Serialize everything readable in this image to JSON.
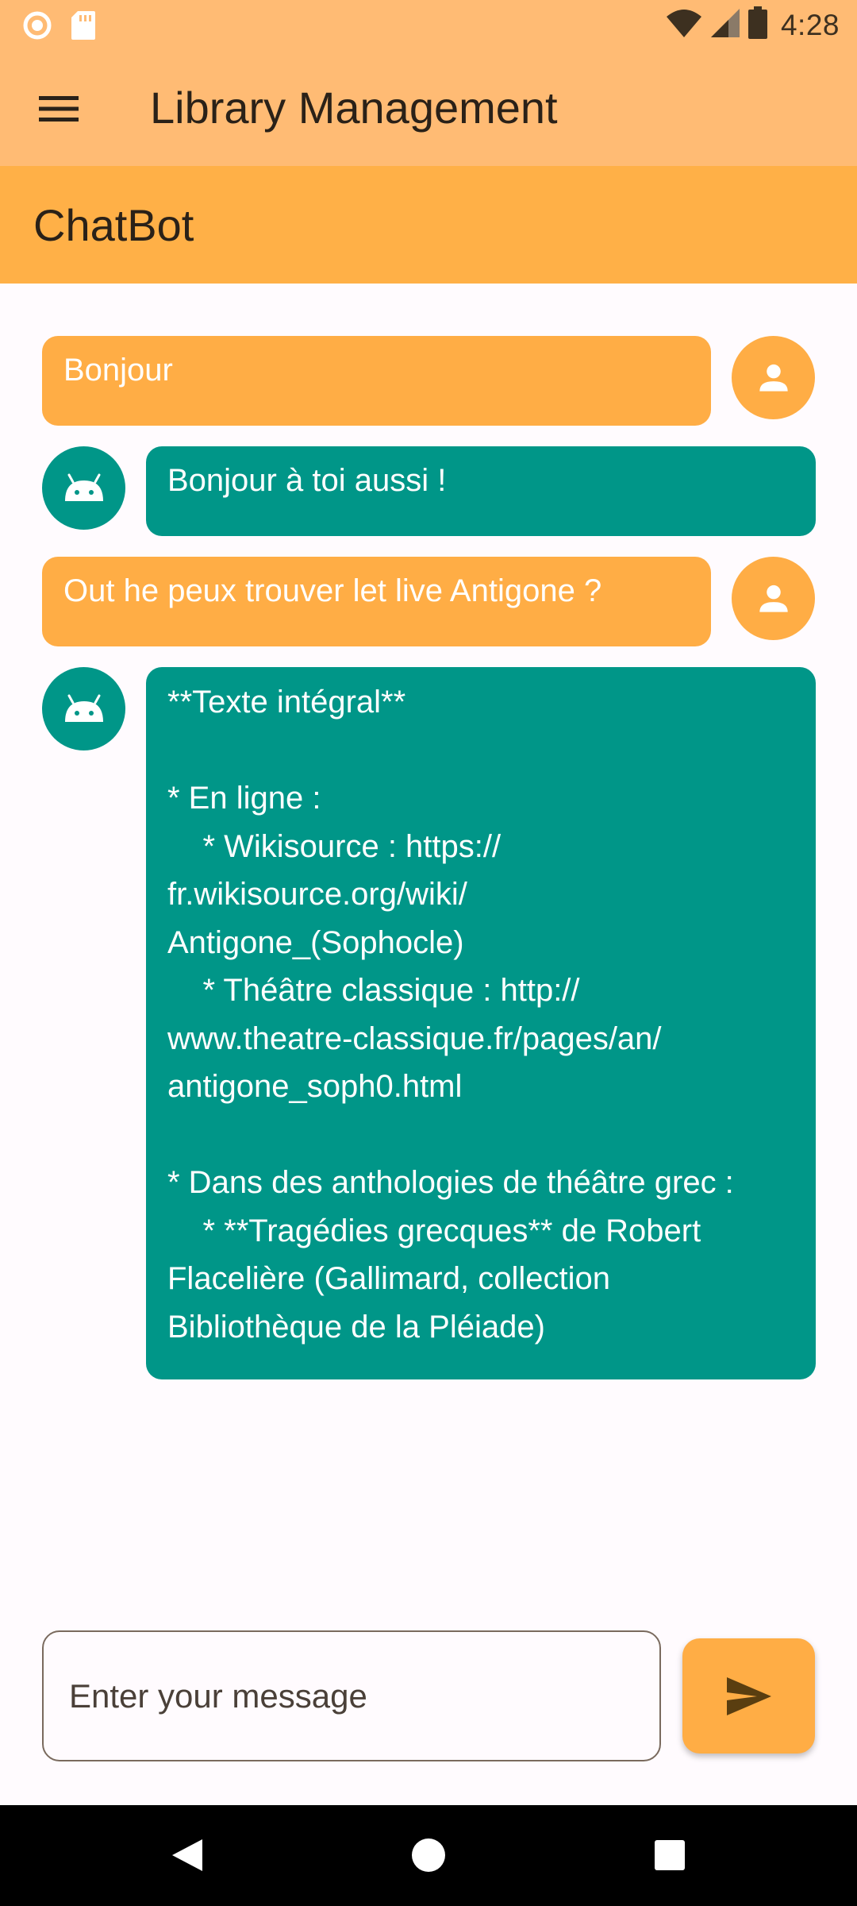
{
  "status_bar": {
    "time": "4:28",
    "icons": [
      "radio-icon",
      "sd-card-icon",
      "wifi-icon",
      "signal-icon",
      "battery-icon"
    ]
  },
  "app_bar": {
    "title": "Library Management",
    "menu_icon": "hamburger-menu-icon"
  },
  "sub_header": {
    "title": "ChatBot"
  },
  "messages": [
    {
      "sender": "user",
      "text": "Bonjour"
    },
    {
      "sender": "bot",
      "text": "Bonjour à toi aussi !"
    },
    {
      "sender": "user",
      "text": "Out he peux trouver let live Antigone ?"
    },
    {
      "sender": "bot",
      "text": "**Texte intégral**\n\n* En ligne :\n    * Wikisource : https://\nfr.wikisource.org/wiki/\nAntigone_(Sophocle)\n    * Théâtre classique : http://\nwww.theatre-classique.fr/pages/an/\nantigone_soph0.html\n\n* Dans des anthologies de théâtre grec :\n    * **Tragédies grecques** de Robert\nFlacelière (Gallimard, collection\nBibliothèque de la Pléiade)"
    }
  ],
  "input": {
    "placeholder": "Enter your message",
    "value": ""
  },
  "send_button": {
    "icon": "send-icon"
  },
  "nav_bar": {
    "icons": [
      "back-icon",
      "home-icon",
      "recents-icon"
    ]
  },
  "colors": {
    "app_bar": "#ffbb74",
    "sub_header": "#ffb047",
    "user_bubble": "#ffad45",
    "bot_bubble": "#009688",
    "background": "#fffbfe"
  }
}
